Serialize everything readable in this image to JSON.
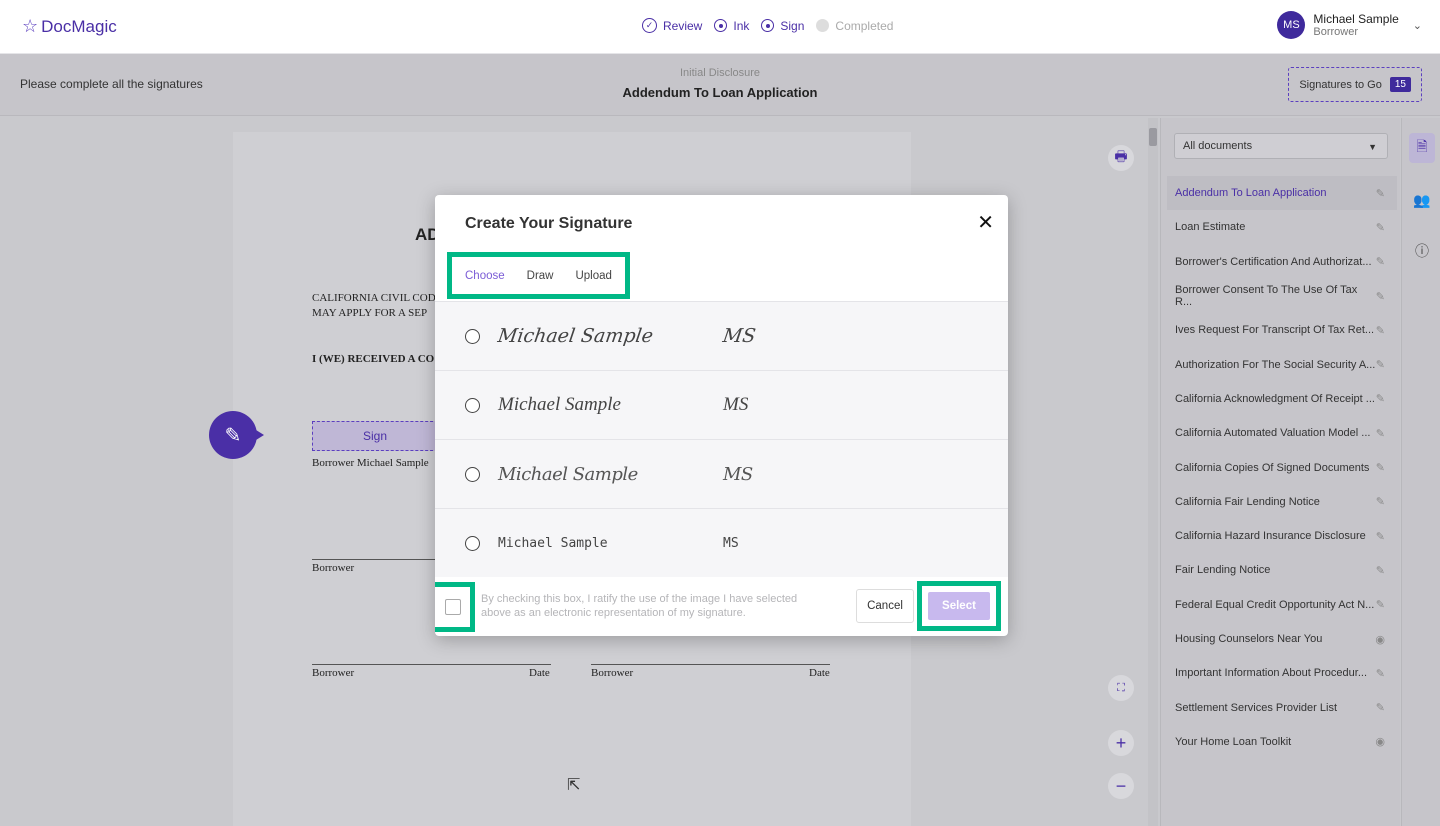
{
  "header": {
    "logo_text": "DocMagic",
    "steps": [
      {
        "label": "Review",
        "state": "done"
      },
      {
        "label": "Ink",
        "state": "current"
      },
      {
        "label": "Sign",
        "state": "current"
      },
      {
        "label": "Completed",
        "state": "pending"
      }
    ],
    "user": {
      "initials": "MS",
      "name": "Michael Sample",
      "role": "Borrower"
    }
  },
  "subheader": {
    "instruction": "Please complete all the signatures",
    "doc_category": "Initial Disclosure",
    "doc_title": "Addendum To Loan Application",
    "signatures_label": "Signatures to Go",
    "signatures_count": "15"
  },
  "document": {
    "title_fragment": "AD",
    "line1": "CALIFORNIA CIVIL COD",
    "line2": "MAY APPLY FOR A SEP",
    "line3": "I (WE) RECEIVED A CO",
    "sign_label": "Sign",
    "borrower_name": "Borrower Michael Sample",
    "borrower_label": "Borrower",
    "date_label": "Date"
  },
  "side_panel": {
    "filter_value": "All documents",
    "documents": [
      {
        "label": "Addendum To Loan Application",
        "icon": "pencil-icon",
        "active": true
      },
      {
        "label": "Loan Estimate",
        "icon": "pencil-icon"
      },
      {
        "label": "Borrower's Certification And Authorizat...",
        "icon": "pencil-icon"
      },
      {
        "label": "Borrower Consent To The Use Of Tax R...",
        "icon": "pencil-icon"
      },
      {
        "label": "Ives Request For Transcript Of Tax Ret...",
        "icon": "pencil-icon"
      },
      {
        "label": "Authorization For The Social Security A...",
        "icon": "pencil-icon"
      },
      {
        "label": "California Acknowledgment Of Receipt ...",
        "icon": "pencil-icon"
      },
      {
        "label": "California Automated Valuation Model ...",
        "icon": "pencil-icon"
      },
      {
        "label": "California Copies Of Signed Documents",
        "icon": "pencil-icon"
      },
      {
        "label": "California Fair Lending Notice",
        "icon": "pencil-icon"
      },
      {
        "label": "California Hazard Insurance Disclosure",
        "icon": "pencil-icon"
      },
      {
        "label": "Fair Lending Notice",
        "icon": "pencil-icon"
      },
      {
        "label": "Federal Equal Credit Opportunity Act N...",
        "icon": "pencil-icon"
      },
      {
        "label": "Housing Counselors Near You",
        "icon": "eye-icon"
      },
      {
        "label": "Important Information About Procedur...",
        "icon": "pencil-icon"
      },
      {
        "label": "Settlement Services Provider List",
        "icon": "pencil-icon"
      },
      {
        "label": "Your Home Loan Toolkit",
        "icon": "eye-icon"
      }
    ]
  },
  "modal": {
    "title": "Create Your Signature",
    "tabs": [
      "Choose",
      "Draw",
      "Upload"
    ],
    "active_tab": "Choose",
    "options": [
      {
        "full": "Michael Sample",
        "initials": "MS"
      },
      {
        "full": "Michael Sample",
        "initials": "MS"
      },
      {
        "full": "Michael Sample",
        "initials": "MS"
      },
      {
        "full": "Michael Sample",
        "initials": "MS"
      }
    ],
    "ratify_text": "By checking this box, I ratify the use of the image I have selected above as an electronic representation of my signature.",
    "cancel_label": "Cancel",
    "select_label": "Select"
  },
  "colors": {
    "accent": "#4a2fa6",
    "highlight": "#00b886",
    "select_disabled": "#c8b9ee"
  }
}
